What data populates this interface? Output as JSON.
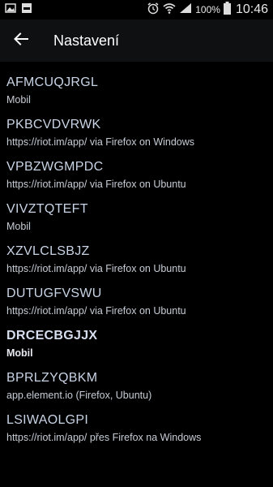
{
  "statusbar": {
    "battery_text": "100%",
    "clock": "10:46",
    "left_icons": [
      "image-icon",
      "notification-icon"
    ],
    "right_icons": [
      "alarm-icon",
      "wifi-icon",
      "signal-icon",
      "battery-icon"
    ]
  },
  "appbar": {
    "title": "Nastavení"
  },
  "sessions": [
    {
      "name": "AFMCUQJRGL",
      "sub": "Mobil"
    },
    {
      "name": "PKBCVDVRWK",
      "sub": "https://riot.im/app/ via Firefox on Windows"
    },
    {
      "name": "VPBZWGMPDC",
      "sub": "https://riot.im/app/ via Firefox on Ubuntu"
    },
    {
      "name": "VIVZTQTEFT",
      "sub": "Mobil"
    },
    {
      "name": "XZVLCLSBJZ",
      "sub": "https://riot.im/app/ via Firefox on Ubuntu"
    },
    {
      "name": "DUTUGFVSWU",
      "sub": "https://riot.im/app/ via Firefox on Ubuntu"
    },
    {
      "name": "DRCECBGJJX",
      "sub": "Mobil"
    },
    {
      "name": "BPRLZYQBKM",
      "sub": "app.element.io (Firefox, Ubuntu)"
    },
    {
      "name": "LSIWAOLGPI",
      "sub": "https://riot.im/app/ přes Firefox na Windows"
    }
  ],
  "colors": {
    "background": "#000000",
    "appbar": "#0f1012",
    "item_name": "#c9d4e6"
  }
}
